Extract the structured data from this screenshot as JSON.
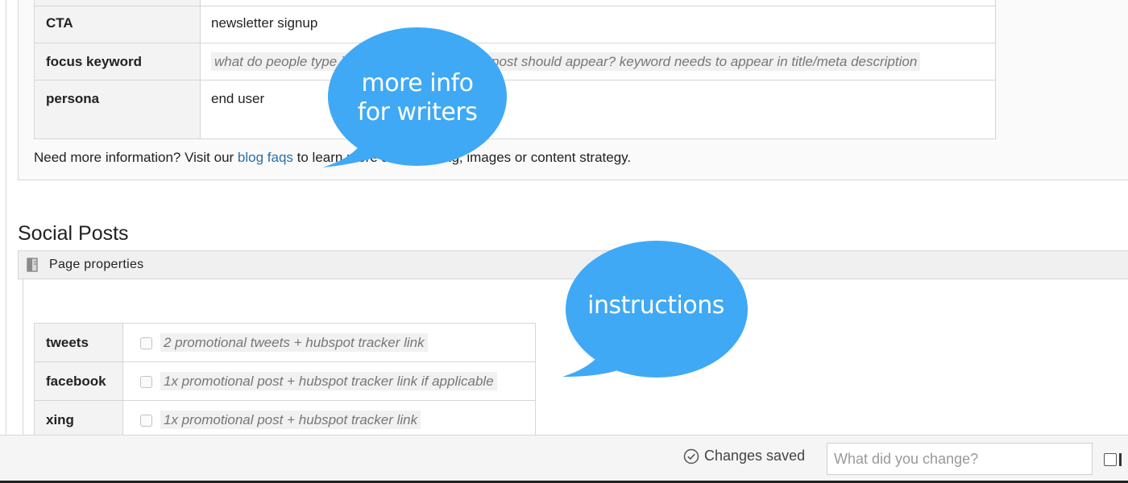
{
  "blog_meta": {
    "rows": [
      {
        "key": "CTA",
        "value": "newsletter signup",
        "is_hint": false
      },
      {
        "key": "focus keyword",
        "value": "what do people type in google when this blog post should appear? keyword needs to appear in title/meta description",
        "is_hint": true
      },
      {
        "key": "persona",
        "value": "end user",
        "is_hint": false
      }
    ],
    "info_prefix": "Need more information? Visit our ",
    "info_link": "blog faqs",
    "info_suffix": " to learn more about writing, images or content strategy."
  },
  "social": {
    "title": "Social Posts",
    "panel_label": "Page properties",
    "rows": [
      {
        "key": "tweets",
        "value": "2 promotional tweets + hubspot tracker link",
        "checked": false
      },
      {
        "key": "facebook",
        "value": "1x promotional post + hubspot tracker link if applicable",
        "checked": false
      },
      {
        "key": "xing",
        "value": "1x promotional post + hubspot tracker link",
        "checked": false
      }
    ]
  },
  "bubbles": {
    "writers_line1": "more info",
    "writers_line2": "for writers",
    "instructions": "instructions",
    "color": "#3fa9f5"
  },
  "bottom_bar": {
    "status": "Changes saved",
    "change_placeholder": "What did you change?"
  },
  "icons": {
    "panel": "panel-icon",
    "saved": "check-circle-icon"
  }
}
